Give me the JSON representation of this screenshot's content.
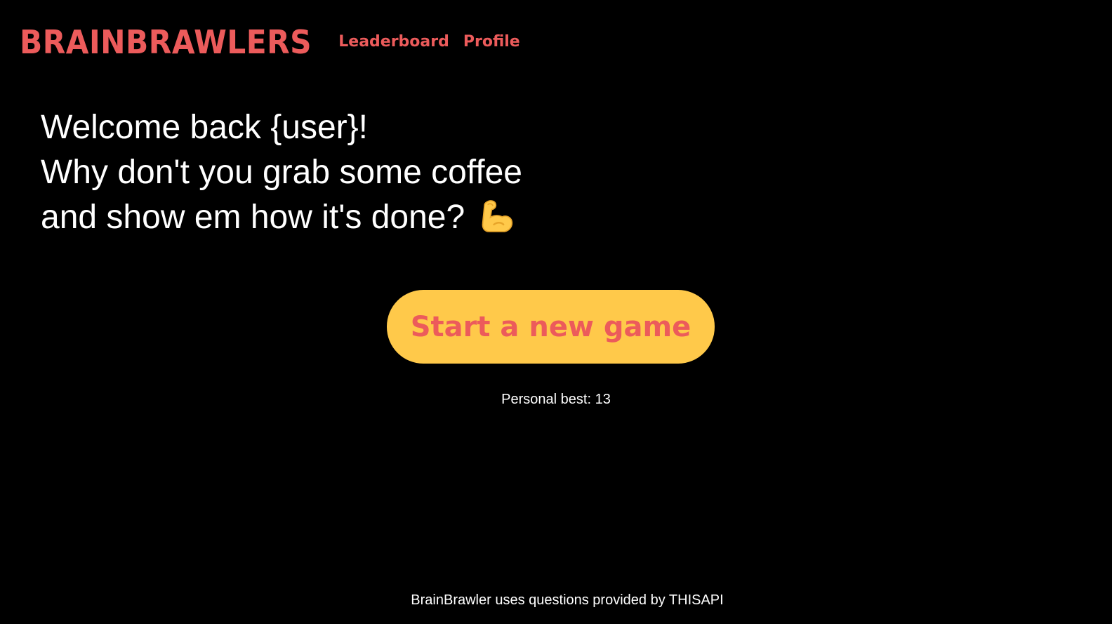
{
  "header": {
    "brand": "BRAINBRAWLERS",
    "nav": [
      {
        "label": "Leaderboard"
      },
      {
        "label": "Profile"
      }
    ]
  },
  "welcome": {
    "line1": "Welcome back {user}!",
    "line2": "Why don't you grab some coffee",
    "line3": "and show em how it's done?",
    "icon": "flexed-biceps-icon"
  },
  "main": {
    "start_button": "Start a new game",
    "personal_best": "Personal best: 13"
  },
  "footer": {
    "text": "BrainBrawler uses questions provided by THISAPI"
  },
  "colors": {
    "background": "#000000",
    "brand": "#ec5b5b",
    "button": "#ffc94a",
    "text": "#ffffff"
  }
}
